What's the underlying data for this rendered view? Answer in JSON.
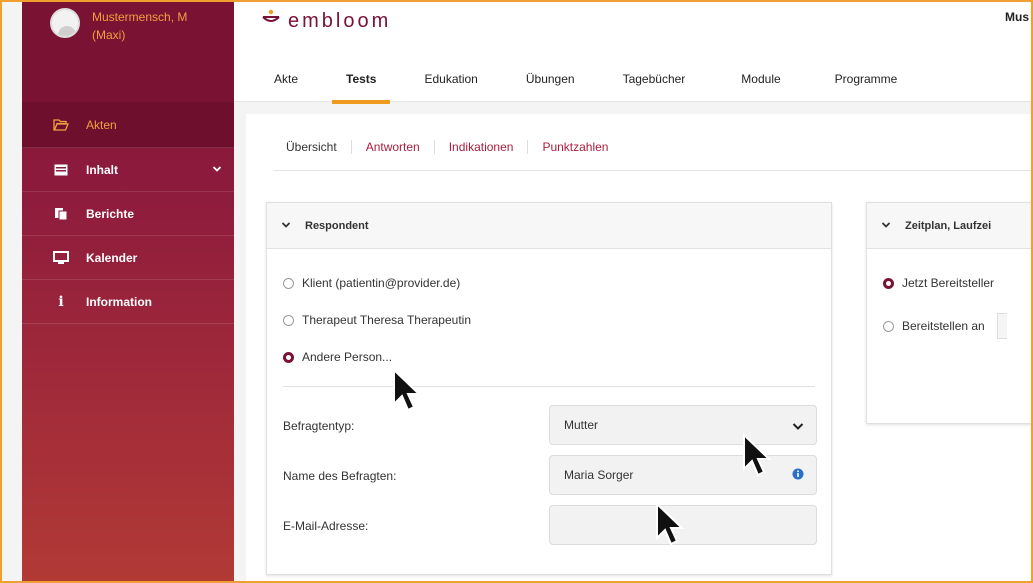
{
  "user": {
    "name_line1": "Mustermensch, M",
    "name_line2": "(Maxi)"
  },
  "sidebar": {
    "items": [
      {
        "label": "Akten",
        "icon": "folder-open-icon",
        "active": true
      },
      {
        "label": "Inhalt",
        "icon": "inbox-icon",
        "has_chevron": true
      },
      {
        "label": "Berichte",
        "icon": "documents-icon"
      },
      {
        "label": "Kalender",
        "icon": "monitor-icon"
      },
      {
        "label": "Information",
        "icon": "info-icon"
      }
    ]
  },
  "header": {
    "logo_text": "embloom",
    "top_right_text": "Mus",
    "tabs": [
      "Akte",
      "Tests",
      "Edukation",
      "Übungen",
      "Tagebücher",
      "Module",
      "Programme"
    ],
    "active_tab": "Tests"
  },
  "subtabs": [
    "Übersicht",
    "Antworten",
    "Indikationen",
    "Punktzahlen"
  ],
  "respondent_panel": {
    "title": "Respondent",
    "options": [
      {
        "label": "Klient (patientin@provider.de)",
        "selected": false
      },
      {
        "label": "Therapeut Theresa Therapeutin",
        "selected": false
      },
      {
        "label": "Andere Person...",
        "selected": true
      }
    ],
    "fields": {
      "befragtentyp_label": "Befragtentyp:",
      "befragtentyp_value": "Mutter",
      "name_label": "Name des Befragten:",
      "name_value": "Maria Sorger",
      "email_label": "E-Mail-Adresse:",
      "email_value": ""
    }
  },
  "schedule_panel": {
    "title": "Zeitplan, Laufzei",
    "options": [
      {
        "label": "Jetzt Bereitsteller",
        "selected": true
      },
      {
        "label": "Bereitstellen an",
        "selected": false
      }
    ]
  },
  "colors": {
    "brand": "#7a1234",
    "accent": "#f09a20",
    "link": "#a8203e"
  }
}
